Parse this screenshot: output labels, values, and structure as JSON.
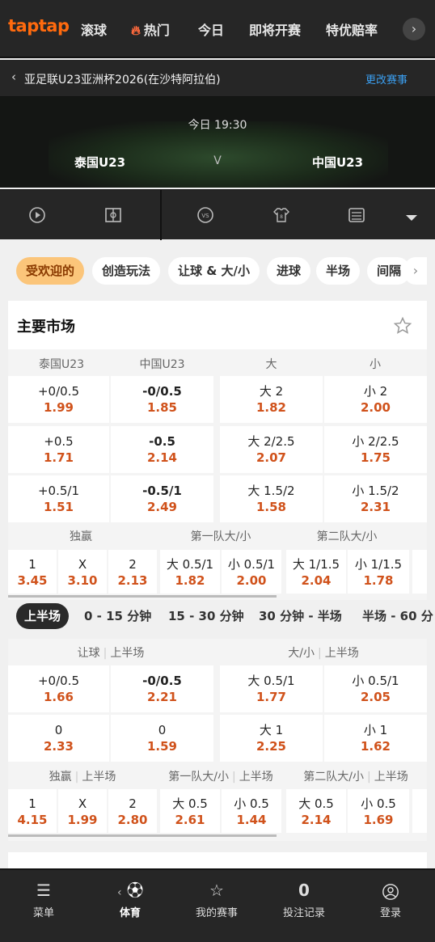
{
  "nav": {
    "logo": "taptap",
    "items": [
      "滚球",
      "热门",
      "今日",
      "即将开赛",
      "特优赔率"
    ],
    "more": "›"
  },
  "breadcrumb": {
    "title": "亚足联U23亚洲杯2026(在沙特阿拉伯)",
    "change": "更改赛事"
  },
  "match": {
    "time": "今日 19:30",
    "home": "泰国U23",
    "vs": "V",
    "away": "中国U23"
  },
  "chips": [
    "受欢迎的",
    "创造玩法",
    "让球 & 大/小",
    "进球",
    "半场",
    "间隔"
  ],
  "main_market": {
    "title": "主要市场",
    "headers": [
      "泰国U23",
      "中国U23",
      "大",
      "小"
    ],
    "rows": [
      [
        {
          "l": "+0/0.5",
          "v": "1.99"
        },
        {
          "l": "-0/0.5",
          "v": "1.85"
        },
        {
          "l": "大 2",
          "v": "1.82"
        },
        {
          "l": "小 2",
          "v": "2.00"
        }
      ],
      [
        {
          "l": "+0.5",
          "v": "1.71"
        },
        {
          "l": "-0.5",
          "v": "2.14"
        },
        {
          "l": "大 2/2.5",
          "v": "2.07"
        },
        {
          "l": "小 2/2.5",
          "v": "1.75"
        }
      ],
      [
        {
          "l": "+0.5/1",
          "v": "1.51"
        },
        {
          "l": "-0.5/1",
          "v": "2.49"
        },
        {
          "l": "大 1.5/2",
          "v": "1.58"
        },
        {
          "l": "小 1.5/2",
          "v": "2.31"
        }
      ]
    ],
    "sub_headers": [
      "独赢",
      "第一队大/小",
      "第二队大/小"
    ],
    "sub_row": [
      {
        "l": "1",
        "v": "3.45"
      },
      {
        "l": "X",
        "v": "3.10"
      },
      {
        "l": "2",
        "v": "2.13"
      },
      {
        "l": "大 0.5/1",
        "v": "1.82"
      },
      {
        "l": "小 0.5/1",
        "v": "2.00"
      },
      {
        "l": "大 1/1.5",
        "v": "2.04"
      },
      {
        "l": "小 1/1.5",
        "v": "1.78"
      }
    ]
  },
  "period_tabs": [
    "上半场",
    "0 - 15 分钟",
    "15 - 30 分钟",
    "30 分钟 - 半场",
    "半场 - 60 分"
  ],
  "first_half": {
    "header_hdp": "让球",
    "header_ou": "大/小",
    "header_suffix": "上半场",
    "rows": [
      [
        {
          "l": "+0/0.5",
          "v": "1.66"
        },
        {
          "l": "-0/0.5",
          "v": "2.21"
        },
        {
          "l": "大 0.5/1",
          "v": "1.77"
        },
        {
          "l": "小 0.5/1",
          "v": "2.05"
        }
      ],
      [
        {
          "l": "0",
          "v": "2.33"
        },
        {
          "l": "0",
          "v": "1.59"
        },
        {
          "l": "大 1",
          "v": "2.25"
        },
        {
          "l": "小 1",
          "v": "1.62"
        }
      ]
    ],
    "sub_headers": [
      "独赢",
      "第一队大/小",
      "第二队大/小"
    ],
    "sub_suffix": "上半场",
    "sub_row": [
      {
        "l": "1",
        "v": "4.15"
      },
      {
        "l": "X",
        "v": "1.99"
      },
      {
        "l": "2",
        "v": "2.80"
      },
      {
        "l": "大 0.5",
        "v": "2.61"
      },
      {
        "l": "小 0.5",
        "v": "1.44"
      },
      {
        "l": "大 0.5",
        "v": "2.14"
      },
      {
        "l": "小 0.5",
        "v": "1.69"
      }
    ]
  },
  "bottom_nav": [
    {
      "label": "菜单",
      "icon": "menu-icon"
    },
    {
      "label": "体育",
      "icon": "soccer-ball-icon"
    },
    {
      "label": "我的赛事",
      "icon": "star-icon"
    },
    {
      "label": "投注记录",
      "count": "0"
    },
    {
      "label": "登录",
      "icon": "user-icon"
    }
  ],
  "colors": {
    "accent": "#ff6a0e",
    "odds": "#d0521b",
    "link": "#3b9ff0",
    "chip_active": "#fbc57a"
  }
}
